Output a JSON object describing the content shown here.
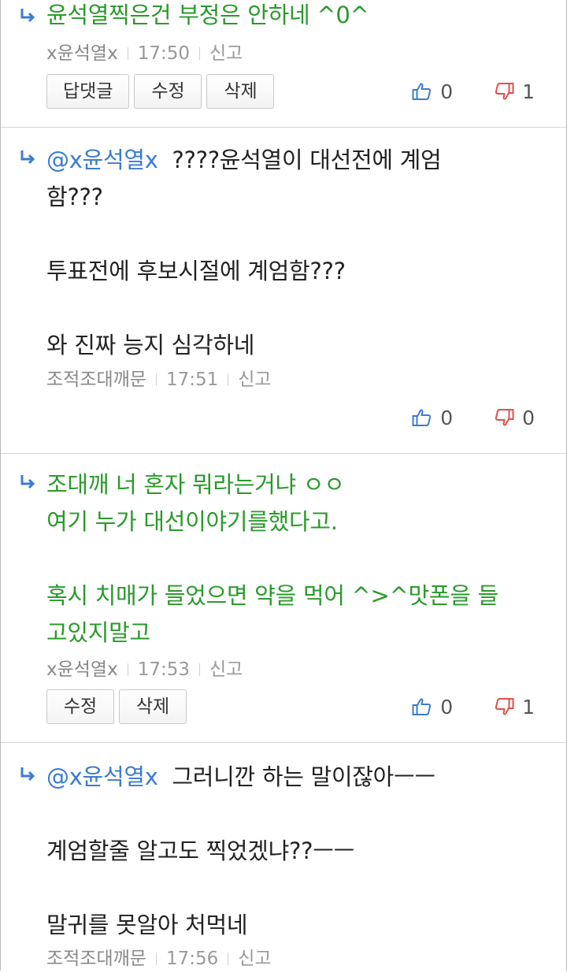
{
  "comments": [
    {
      "text_plain": "윤석열찍은건 부정은 안하네 ^0^",
      "author": "x윤석열x",
      "time": "17:50",
      "report": "신고",
      "buttons": [
        "답댓글",
        "수정",
        "삭제"
      ],
      "up": "0",
      "down": "1",
      "color": "#2a9a2a"
    },
    {
      "mention": "@x윤석열x",
      "text_after_mention": "  ????윤석열이 대선전에 계엄\n함???\n\n투표전에 후보시절에 계엄함???\n\n와 진짜 능지 심각하네",
      "author": "조적조대깨문",
      "time": "17:51",
      "report": "신고",
      "up": "0",
      "down": "0"
    },
    {
      "text_plain": "조대깨 너 혼자 뭐라는거냐 ㅇㅇ\n여기 누가 대선이야기를했다고.\n\n혹시 치매가 들었으면 약을 먹어 ^>^맛폰을 들\n고있지말고",
      "author": "x윤석열x",
      "time": "17:53",
      "report": "신고",
      "buttons": [
        "수정",
        "삭제"
      ],
      "up": "0",
      "down": "1",
      "color": "#2a9a2a"
    },
    {
      "mention": "@x윤석열x",
      "text_after_mention": "  그러니깐 하는 말이잖아ㅡㅡ\n\n계엄할줄 알고도 찍었겠냐??ㅡㅡ\n\n말귀를 못알아 처먹네",
      "author": "조적조대깨문",
      "time": "17:56",
      "report": "신고"
    }
  ],
  "icons": {
    "reply": "reply-arrow-icon",
    "like": "thumbs-up-icon",
    "dislike": "thumbs-down-icon"
  },
  "colors": {
    "mention": "#3b7bd1",
    "green_text": "#2a9a2a",
    "like": "#3b7bd1",
    "dislike": "#e0504a"
  }
}
